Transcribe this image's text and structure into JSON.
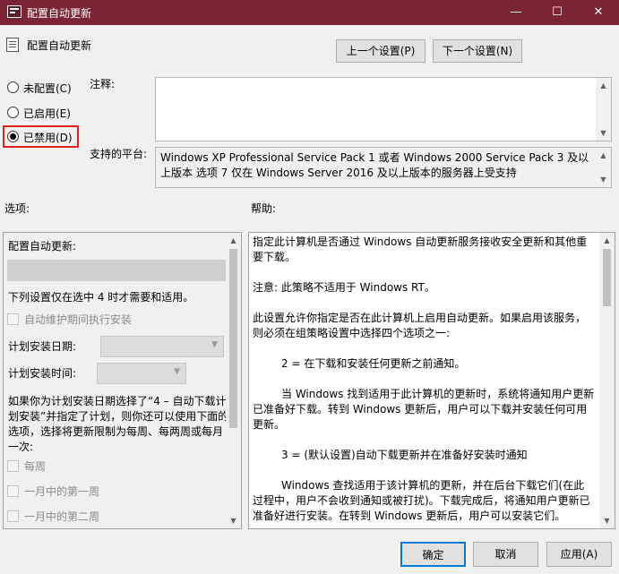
{
  "window": {
    "title": "配置自动更新",
    "minimize": "—",
    "maximize": "☐",
    "close": "✕"
  },
  "header": {
    "title": "配置自动更新",
    "prev_button": "上一个设置(P)",
    "next_button": "下一个设置(N)"
  },
  "radios": [
    {
      "label": "未配置(C)",
      "checked": false
    },
    {
      "label": "已启用(E)",
      "checked": false
    },
    {
      "label": "已禁用(D)",
      "checked": true
    }
  ],
  "comment": {
    "label": "注释:",
    "value": ""
  },
  "platform": {
    "label": "支持的平台:",
    "text": "Windows XP Professional Service Pack 1 或者 Windows 2000 Service Pack 3 及以上版本 选项 7 仅在 Windows Server 2016 及以上版本的服务器上受支持"
  },
  "options": {
    "section_label": "选项:",
    "title": "配置自动更新:",
    "note": "下列设置仅在选中 4 时才需要和适用。",
    "maintenance_checkbox": "自动维护期间执行安装",
    "schedule_day_label": "计划安装日期:",
    "schedule_time_label": "计划安装时间:",
    "paragraph": "如果你为计划安装日期选择了“4 – 自动下载计划安装”并指定了计划，则你还可以使用下面的选项，选择将更新限制为每周、每两周或每月一次:",
    "weekly_checkbox": "每周",
    "first_week_checkbox": "一月中的第一周",
    "second_week_checkbox": "一月中的第二周"
  },
  "help": {
    "section_label": "帮助:",
    "paragraphs": [
      "指定此计算机是否通过 Windows 自动更新服务接收安全更新和其他重要下载。",
      "注意: 此策略不适用于 Windows RT。",
      "此设置允许你指定是否在此计算机上启用自动更新。如果启用该服务，则必须在组策略设置中选择四个选项之一:",
      "2 = 在下载和安装任何更新之前通知。",
      "当 Windows 找到适用于此计算机的更新时，系统将通知用户更新已准备好下载。转到 Windows 更新后，用户可以下载并安装任何可用更新。",
      "3 = (默认设置)自动下载更新并在准备好安装时通知",
      "Windows 查找适用于该计算机的更新，并在后台下载它们(在此过程中，用户不会收到通知或被打扰)。下载完成后，将通知用户更新已准备好进行安装。在转到 Windows 更新后，用户可以安装它们。"
    ]
  },
  "footer": {
    "ok": "确定",
    "cancel": "取消",
    "apply": "应用(A)"
  },
  "colors": {
    "titlebar": "#7b2434",
    "highlight_border": "#e0201e",
    "default_button_border": "#0078d7"
  }
}
